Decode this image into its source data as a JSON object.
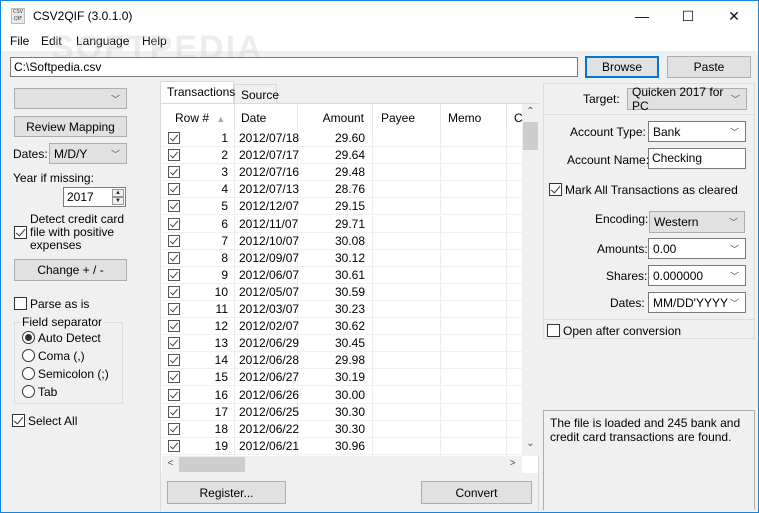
{
  "window": {
    "title": "CSV2QIF (3.0.1.0)",
    "icon_text_top": "CSV",
    "icon_text_bottom": "QIF",
    "minimize": "—",
    "maximize": "☐",
    "close": "✕",
    "border_color": "#1883d7"
  },
  "menu": [
    "File",
    "Edit",
    "Language",
    "Help"
  ],
  "watermark": "SOFTPEDIA",
  "file": {
    "path": "C:\\Softpedia.csv",
    "browse_label": "Browse",
    "paste_label": "Paste"
  },
  "left": {
    "mapping_combo_value": "",
    "review_mapping_label": "Review Mapping",
    "dates_label": "Dates:",
    "dates_value": "M/D/Y",
    "year_missing_label": "Year if missing:",
    "year_value": "2017",
    "detect_credit_label": "Detect credit card file with positive expenses",
    "detect_credit_line1": "Detect credit card",
    "detect_credit_line2": "file with positive",
    "detect_credit_line3": "expenses",
    "detect_credit_checked": true,
    "change_sign_label": "Change + / -",
    "parse_as_is_label": "Parse as is",
    "parse_as_is_checked": false,
    "field_separator_title": "Field separator",
    "separators": [
      {
        "label": "Auto Detect",
        "checked": true
      },
      {
        "label": "Coma (,)",
        "checked": false
      },
      {
        "label": "Semicolon (;)",
        "checked": false
      },
      {
        "label": "Tab",
        "checked": false
      }
    ],
    "select_all_label": "Select All",
    "select_all_checked": true
  },
  "tabs": [
    {
      "label": "Transactions",
      "active": true
    },
    {
      "label": "Source",
      "active": false
    }
  ],
  "grid": {
    "columns": [
      "Row #",
      "Date",
      "Amount",
      "Payee",
      "Memo",
      "C"
    ],
    "sort_indicator": "▲",
    "rows": [
      {
        "n": "1",
        "date": "2012/07/18",
        "amount": "29.60",
        "checked": true
      },
      {
        "n": "2",
        "date": "2012/07/17",
        "amount": "29.64",
        "checked": true
      },
      {
        "n": "3",
        "date": "2012/07/16",
        "amount": "29.48",
        "checked": true
      },
      {
        "n": "4",
        "date": "2012/07/13",
        "amount": "28.76",
        "checked": true
      },
      {
        "n": "5",
        "date": "2012/12/07",
        "amount": "29.15",
        "checked": true
      },
      {
        "n": "6",
        "date": "2012/11/07",
        "amount": "29.71",
        "checked": true
      },
      {
        "n": "7",
        "date": "2012/10/07",
        "amount": "30.08",
        "checked": true
      },
      {
        "n": "8",
        "date": "2012/09/07",
        "amount": "30.12",
        "checked": true
      },
      {
        "n": "9",
        "date": "2012/06/07",
        "amount": "30.61",
        "checked": true
      },
      {
        "n": "10",
        "date": "2012/05/07",
        "amount": "30.59",
        "checked": true
      },
      {
        "n": "11",
        "date": "2012/03/07",
        "amount": "30.23",
        "checked": true
      },
      {
        "n": "12",
        "date": "2012/02/07",
        "amount": "30.62",
        "checked": true
      },
      {
        "n": "13",
        "date": "2012/06/29",
        "amount": "30.45",
        "checked": true
      },
      {
        "n": "14",
        "date": "2012/06/28",
        "amount": "29.98",
        "checked": true
      },
      {
        "n": "15",
        "date": "2012/06/27",
        "amount": "30.19",
        "checked": true
      },
      {
        "n": "16",
        "date": "2012/06/26",
        "amount": "30.00",
        "checked": true
      },
      {
        "n": "17",
        "date": "2012/06/25",
        "amount": "30.30",
        "checked": true
      },
      {
        "n": "18",
        "date": "2012/06/22",
        "amount": "30.30",
        "checked": true
      },
      {
        "n": "19",
        "date": "2012/06/21",
        "amount": "30.96",
        "checked": true
      },
      {
        "n": "",
        "date": "",
        "amount": "",
        "checked": true
      }
    ]
  },
  "bottom": {
    "register_label": "Register...",
    "convert_label": "Convert"
  },
  "right": {
    "target_label": "Target:",
    "target_value": "Quicken 2017 for PC",
    "account_type_label": "Account Type:",
    "account_type_value": "Bank",
    "account_name_label": "Account Name:",
    "account_name_value": "Checking",
    "mark_cleared_label": "Mark All Transactions as cleared",
    "mark_cleared_checked": true,
    "encoding_label": "Encoding:",
    "encoding_value": "Western",
    "amounts_label": "Amounts:",
    "amounts_value": "0.00",
    "shares_label": "Shares:",
    "shares_value": "0.000000",
    "dates_label": "Dates:",
    "dates_value": "MM/DD'YYYY",
    "open_after_label": "Open after conversion",
    "open_after_checked": false,
    "status_message": "The file is loaded and 245 bank and credit card transactions are found."
  },
  "icons": {
    "chevron_down": "﹀",
    "scroll_up": "⌃",
    "scroll_down": "⌄",
    "scroll_left": "<",
    "scroll_right": ">",
    "spin_up": "▲",
    "spin_down": "▼"
  }
}
